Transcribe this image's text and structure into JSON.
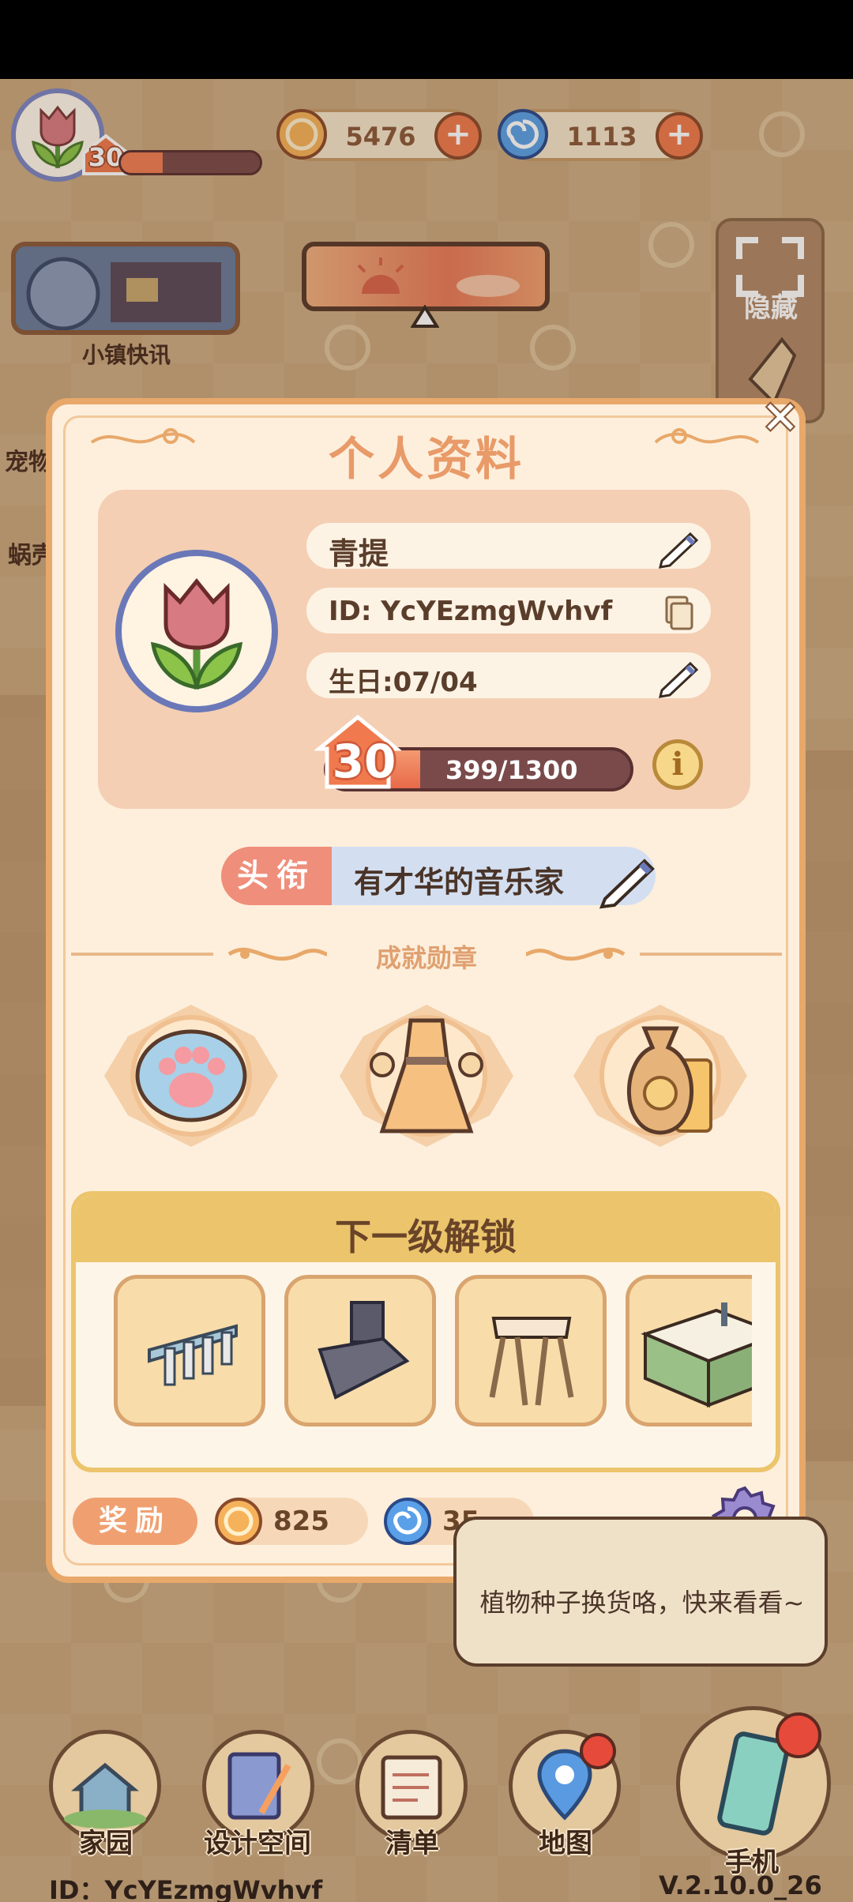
{
  "hud": {
    "player_level": "30",
    "xp_fraction": 0.3,
    "coins": "5476",
    "gems": "1113",
    "plus_symbol": "+"
  },
  "side": {
    "news_label": "小镇快讯",
    "hide_label": "隐藏",
    "left_label_1": "宠物",
    "left_label_2": "蜗壳"
  },
  "dialog": {
    "title": "个人资料",
    "close_symbol": "✕",
    "name": "青提",
    "id_text": "ID: YcYEzmgWvhvf",
    "birthday": "生日:07/04",
    "level": "30",
    "xp_text": "399/1300",
    "xp_fraction": 0.307,
    "info_symbol": "i",
    "title_tag": "头衔",
    "title_value": "有才华的音乐家",
    "achievements_label": "成就勋章",
    "achievements": [
      "paw-badge",
      "dress-badge",
      "money-bag-badge"
    ],
    "unlock_title": "下一级解锁",
    "unlock_items": [
      "knife-rack",
      "range-hood",
      "stool",
      "sink-counter"
    ],
    "reward_label": "奖励",
    "reward_coins": "825",
    "reward_gems": "35"
  },
  "bubble": {
    "text": "植物种子换货咯，快来看看~"
  },
  "nav": {
    "items": [
      {
        "label": "家园",
        "icon": "house-icon"
      },
      {
        "label": "设计空间",
        "icon": "design-icon"
      },
      {
        "label": "清单",
        "icon": "list-icon"
      },
      {
        "label": "地图",
        "icon": "map-pin-icon"
      }
    ],
    "phone_label": "手机"
  },
  "footer": {
    "id": "ID：YcYEzmgWvhvf",
    "version": "V.2.10.0_26"
  },
  "colors": {
    "accent_orange": "#ef7e54",
    "dialog_bg": "#fdefdc",
    "dialog_border": "#e8a86a",
    "title_tag": "#ef8e7a",
    "unlock_header": "#ecc46c"
  }
}
